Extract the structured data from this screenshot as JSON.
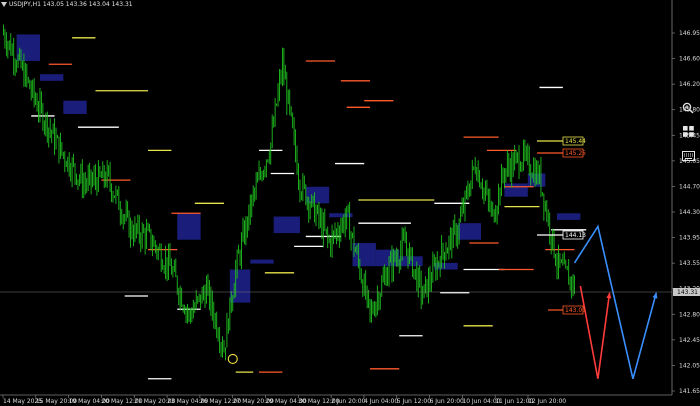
{
  "window": {
    "symbol": "USDJPY,H1",
    "ohlc": "143.05 143.36 143.04 143.31",
    "current_price": "143.31"
  },
  "colors": {
    "background": "#000000",
    "candles": "#1fbf1f",
    "zone": "#1a1e7a",
    "level_white": "#ffffff",
    "level_yellow": "#e8e34a",
    "level_orange": "#ff5a2a",
    "arrow_red": "#ff3b3b",
    "arrow_blue": "#3a8fff"
  },
  "price_axis": {
    "ticks": [
      "146.95",
      "146.60",
      "146.20",
      "145.80",
      "145.45",
      "145.05",
      "144.70",
      "144.30",
      "143.95",
      "143.55",
      "143.20",
      "142.80",
      "142.45",
      "142.05",
      "141.65"
    ]
  },
  "price_labels": {
    "yellow": "145.44",
    "orange_top": "145.25",
    "white": "144.13",
    "orange_bottom": "143.05"
  },
  "time_axis": {
    "ticks": [
      "14 May 2025",
      "15 May 20:00",
      "19 May 04:00",
      "20 May 12:00",
      "21 May 20:00",
      "23 May 04:00",
      "26 May 12:00",
      "27 May 20:00",
      "29 May 04:00",
      "30 May 12:00",
      "2 Jun 20:00",
      "4 Jun 04:00",
      "5 Jun 12:00",
      "6 Jun 20:00",
      "10 Jun 04:00",
      "11 Jun 12:00",
      "12 Jun 20:00"
    ]
  },
  "sidebar": {
    "icons": [
      "zoom-in-icon",
      "grid-layout-icon",
      "keyboard-icon"
    ]
  },
  "chart_data": {
    "type": "candlestick",
    "symbol": "USDJPY",
    "timeframe": "H1",
    "y_range": [
      141.45,
      147.25
    ],
    "close_path": [
      {
        "t": 0,
        "p": 146.9
      },
      {
        "t": 3,
        "p": 146.4
      },
      {
        "t": 6,
        "p": 145.8
      },
      {
        "t": 10,
        "p": 145.1
      },
      {
        "t": 14,
        "p": 144.6
      },
      {
        "t": 18,
        "p": 144.7
      },
      {
        "t": 22,
        "p": 143.9
      },
      {
        "t": 25,
        "p": 143.8
      },
      {
        "t": 29,
        "p": 143.3
      },
      {
        "t": 32,
        "p": 142.6
      },
      {
        "t": 35,
        "p": 143.0
      },
      {
        "t": 38,
        "p": 142.1
      },
      {
        "t": 40,
        "p": 143.3
      },
      {
        "t": 43,
        "p": 144.4
      },
      {
        "t": 46,
        "p": 145.2
      },
      {
        "t": 48,
        "p": 146.4
      },
      {
        "t": 51,
        "p": 144.6
      },
      {
        "t": 54,
        "p": 144.1
      },
      {
        "t": 56,
        "p": 143.7
      },
      {
        "t": 59,
        "p": 144.1
      },
      {
        "t": 61,
        "p": 143.4
      },
      {
        "t": 63,
        "p": 142.6
      },
      {
        "t": 66,
        "p": 143.3
      },
      {
        "t": 69,
        "p": 143.7
      },
      {
        "t": 72,
        "p": 142.9
      },
      {
        "t": 75,
        "p": 143.5
      },
      {
        "t": 78,
        "p": 143.9
      },
      {
        "t": 81,
        "p": 144.9
      },
      {
        "t": 84,
        "p": 144.1
      },
      {
        "t": 86,
        "p": 144.8
      },
      {
        "t": 89,
        "p": 145.0
      },
      {
        "t": 92,
        "p": 144.7
      },
      {
        "t": 95,
        "p": 143.4
      },
      {
        "t": 98,
        "p": 143.05
      }
    ],
    "levels": [
      {
        "color": "white",
        "price": 145.62,
        "t0": 5,
        "t1": 9
      },
      {
        "color": "yellow",
        "price": 146.8,
        "t0": 12,
        "t1": 16
      },
      {
        "color": "orange",
        "price": 146.4,
        "t0": 8,
        "t1": 12
      },
      {
        "color": "yellow",
        "price": 146.0,
        "t0": 16,
        "t1": 25
      },
      {
        "color": "yellow",
        "price": 145.1,
        "t0": 25,
        "t1": 29
      },
      {
        "color": "orange",
        "price": 144.65,
        "t0": 17,
        "t1": 22
      },
      {
        "color": "orange",
        "price": 144.15,
        "t0": 29,
        "t1": 34
      },
      {
        "color": "yellow",
        "price": 144.3,
        "t0": 33,
        "t1": 38
      },
      {
        "color": "white",
        "price": 144.75,
        "t0": 46,
        "t1": 50
      },
      {
        "color": "white",
        "price": 143.8,
        "t0": 52,
        "t1": 58
      },
      {
        "color": "yellow",
        "price": 143.25,
        "t0": 45,
        "t1": 50
      },
      {
        "color": "orange",
        "price": 143.6,
        "t0": 25,
        "t1": 30
      },
      {
        "color": "white",
        "price": 142.9,
        "t0": 21,
        "t1": 25
      },
      {
        "color": "white",
        "price": 142.7,
        "t0": 30,
        "t1": 34
      },
      {
        "color": "white",
        "price": 141.65,
        "t0": 25,
        "t1": 29
      },
      {
        "color": "white",
        "price": 142.95,
        "t0": 75,
        "t1": 80
      },
      {
        "color": "white",
        "price": 142.3,
        "t0": 68,
        "t1": 72
      },
      {
        "color": "yellow",
        "price": 142.45,
        "t0": 79,
        "t1": 84
      },
      {
        "color": "orange",
        "price": 141.8,
        "t0": 63,
        "t1": 68
      },
      {
        "color": "orange",
        "price": 146.45,
        "t0": 52,
        "t1": 57
      },
      {
        "color": "orange",
        "price": 145.85,
        "t0": 62,
        "t1": 67
      },
      {
        "color": "orange",
        "price": 146.15,
        "t0": 58,
        "t1": 63
      },
      {
        "color": "orange",
        "price": 145.3,
        "t0": 79,
        "t1": 85
      },
      {
        "color": "white",
        "price": 146.05,
        "t0": 92,
        "t1": 96
      },
      {
        "color": "white",
        "price": 144.9,
        "t0": 57,
        "t1": 62
      },
      {
        "color": "yellow",
        "price": 144.35,
        "t0": 61,
        "t1": 74
      },
      {
        "color": "white",
        "price": 144.0,
        "t0": 61,
        "t1": 70
      },
      {
        "color": "orange",
        "price": 143.7,
        "t0": 80,
        "t1": 85
      },
      {
        "color": "white",
        "price": 143.65,
        "t0": 50,
        "t1": 55
      },
      {
        "color": "white",
        "price": 144.3,
        "t0": 74,
        "t1": 80
      },
      {
        "color": "white",
        "price": 143.3,
        "t0": 79,
        "t1": 86
      },
      {
        "color": "orange",
        "price": 143.3,
        "t0": 85,
        "t1": 91
      },
      {
        "color": "yellow",
        "price": 144.25,
        "t0": 86,
        "t1": 92
      },
      {
        "color": "orange",
        "price": 145.1,
        "t0": 83,
        "t1": 88
      },
      {
        "color": "white",
        "price": 143.9,
        "t0": 94,
        "t1": 100
      },
      {
        "color": "orange",
        "price": 144.55,
        "t0": 86,
        "t1": 91
      },
      {
        "color": "orange",
        "price": 143.6,
        "t0": 93,
        "t1": 98
      },
      {
        "color": "white",
        "price": 145.45,
        "t0": 13,
        "t1": 20
      },
      {
        "color": "orange",
        "price": 145.75,
        "t0": 59,
        "t1": 63
      },
      {
        "color": "white",
        "price": 145.1,
        "t0": 44,
        "t1": 48
      },
      {
        "color": "orange",
        "price": 141.75,
        "t0": 44,
        "t1": 48
      },
      {
        "color": "yellow",
        "price": 141.75,
        "t0": 40,
        "t1": 43
      }
    ],
    "zones": [
      {
        "t0": 2.5,
        "t1": 6.5,
        "p0": 146.85,
        "p1": 146.45
      },
      {
        "t0": 6.5,
        "t1": 10.5,
        "p0": 146.25,
        "p1": 146.15
      },
      {
        "t0": 10.5,
        "t1": 14.5,
        "p0": 145.85,
        "p1": 145.65
      },
      {
        "t0": 30,
        "t1": 34,
        "p0": 144.15,
        "p1": 143.75
      },
      {
        "t0": 39,
        "t1": 42.5,
        "p0": 143.3,
        "p1": 142.8
      },
      {
        "t0": 42.5,
        "t1": 46.5,
        "p0": 143.45,
        "p1": 143.4
      },
      {
        "t0": 46.5,
        "t1": 51,
        "p0": 144.1,
        "p1": 143.85
      },
      {
        "t0": 52,
        "t1": 56,
        "p0": 144.55,
        "p1": 144.3
      },
      {
        "t0": 56,
        "t1": 60,
        "p0": 144.15,
        "p1": 144.1
      },
      {
        "t0": 60,
        "t1": 64,
        "p0": 143.7,
        "p1": 143.35
      },
      {
        "t0": 64,
        "t1": 68,
        "p0": 143.6,
        "p1": 143.35
      },
      {
        "t0": 68,
        "t1": 72,
        "p0": 143.5,
        "p1": 143.35
      },
      {
        "t0": 74,
        "t1": 78,
        "p0": 143.4,
        "p1": 143.3
      },
      {
        "t0": 78,
        "t1": 82,
        "p0": 144.0,
        "p1": 143.75
      },
      {
        "t0": 86,
        "t1": 90,
        "p0": 144.6,
        "p1": 144.4
      },
      {
        "t0": 90,
        "t1": 93,
        "p0": 144.75,
        "p1": 144.55
      },
      {
        "t0": 95,
        "t1": 99,
        "p0": 144.15,
        "p1": 144.05
      }
    ],
    "projection": {
      "red": [
        {
          "t": 99,
          "p": 143.05
        },
        {
          "t": 102,
          "p": 141.65
        },
        {
          "t": 104,
          "p": 142.95
        }
      ],
      "blue": [
        {
          "t": 98,
          "p": 143.4
        },
        {
          "t": 102,
          "p": 143.95
        },
        {
          "t": 108,
          "p": 141.65
        },
        {
          "t": 112,
          "p": 142.95
        }
      ]
    },
    "marker_circle": {
      "t": 39.5,
      "p": 141.95
    }
  }
}
